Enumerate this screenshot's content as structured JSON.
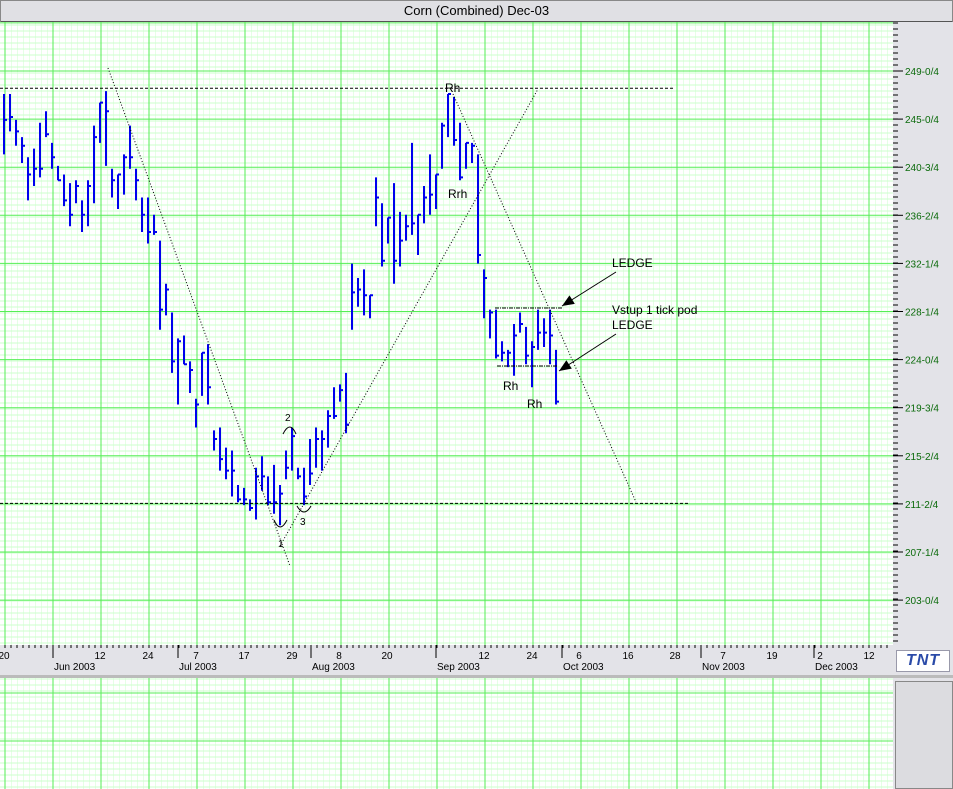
{
  "window": {
    "title": "Corn (Combined) Dec-03"
  },
  "logo": {
    "text": "TNT"
  },
  "colors": {
    "bar": "#0000ee",
    "grid_major": "#55ee55",
    "grid_minor": "#ccffcc",
    "axis_label": "#0a6a0a"
  },
  "chart_data": {
    "type": "ohlc",
    "title": "Corn (Combined) Dec-03",
    "fields": [
      "high",
      "low",
      "close"
    ],
    "bars": [
      [
        247.0,
        241.75,
        244.75
      ],
      [
        247.0,
        243.75,
        245.0
      ],
      [
        244.75,
        242.5,
        243.75
      ],
      [
        243.25,
        241.0,
        242.5
      ],
      [
        241.5,
        237.75,
        240.0
      ],
      [
        242.25,
        239.0,
        240.5
      ],
      [
        244.5,
        239.75,
        240.5
      ],
      [
        245.5,
        243.25,
        243.5
      ],
      [
        242.75,
        240.5,
        241.5
      ],
      [
        240.75,
        239.5,
        239.5
      ],
      [
        240.0,
        237.25,
        237.75
      ],
      [
        239.25,
        235.5,
        236.5
      ],
      [
        239.5,
        237.5,
        239.0
      ],
      [
        237.75,
        235.0,
        236.5
      ],
      [
        239.5,
        235.5,
        239.0
      ],
      [
        244.25,
        237.5,
        243.25
      ],
      [
        246.25,
        242.75,
        246.25
      ],
      [
        247.25,
        240.75,
        245.5
      ],
      [
        240.5,
        238.0,
        239.5
      ],
      [
        240.0,
        237.0,
        240.0
      ],
      [
        241.75,
        238.25,
        241.5
      ],
      [
        244.25,
        240.5,
        241.5
      ],
      [
        240.5,
        237.75,
        239.5
      ],
      [
        238.0,
        235.0,
        236.5
      ],
      [
        238.0,
        234.0,
        235.0
      ],
      [
        236.5,
        234.75,
        235.0
      ],
      [
        234.25,
        226.5,
        228.25
      ],
      [
        230.5,
        227.75,
        230.0
      ],
      [
        228.0,
        222.75,
        223.75
      ],
      [
        225.75,
        220.0,
        225.5
      ],
      [
        226.0,
        223.5,
        223.5
      ],
      [
        223.75,
        221.0,
        223.0
      ],
      [
        220.5,
        218.0,
        220.0
      ],
      [
        224.5,
        220.75,
        224.5
      ],
      [
        225.25,
        220.0,
        221.5
      ],
      [
        217.75,
        216.0,
        217.0
      ],
      [
        218.0,
        214.25,
        215.25
      ],
      [
        216.25,
        213.5,
        214.25
      ],
      [
        216.0,
        212.0,
        214.25
      ],
      [
        213.0,
        211.5,
        211.75
      ],
      [
        212.75,
        211.25,
        211.75
      ],
      [
        211.75,
        210.75,
        211.0
      ],
      [
        214.5,
        210.0,
        213.75
      ],
      [
        215.5,
        212.5,
        213.75
      ],
      [
        213.75,
        211.25,
        211.5
      ],
      [
        214.75,
        210.5,
        211.5
      ],
      [
        213.0,
        209.5,
        212.25
      ],
      [
        216.0,
        213.5,
        214.5
      ],
      [
        218.0,
        214.25,
        217.25
      ],
      [
        214.5,
        213.5,
        213.75
      ],
      [
        214.5,
        211.25,
        212.0
      ],
      [
        217.0,
        213.0,
        214.0
      ],
      [
        218.0,
        214.5,
        217.0
      ],
      [
        217.75,
        214.25,
        217.0
      ],
      [
        219.5,
        216.25,
        219.0
      ],
      [
        221.5,
        218.75,
        219.0
      ],
      [
        221.75,
        220.25,
        221.25
      ],
      [
        222.75,
        217.5,
        218.25
      ],
      [
        232.25,
        226.5,
        229.75
      ],
      [
        231.0,
        228.5,
        230.0
      ],
      [
        231.75,
        227.75,
        229.5
      ],
      [
        229.5,
        227.5,
        229.5
      ],
      [
        239.75,
        235.5,
        238.0
      ],
      [
        237.5,
        232.0,
        232.5
      ],
      [
        236.25,
        234.0,
        236.25
      ],
      [
        239.25,
        230.5,
        232.5
      ],
      [
        236.75,
        232.0,
        234.25
      ],
      [
        236.5,
        234.25,
        235.5
      ],
      [
        242.75,
        234.75,
        235.75
      ],
      [
        236.5,
        233.0,
        236.5
      ],
      [
        239.0,
        235.75,
        238.0
      ],
      [
        241.75,
        236.5,
        238.25
      ],
      [
        240.0,
        237.0,
        240.0
      ],
      [
        244.5,
        240.5,
        244.25
      ],
      [
        247.0,
        243.25,
        247.0
      ],
      [
        246.75,
        242.5,
        243.0
      ],
      [
        244.5,
        239.5,
        239.75
      ],
      [
        242.75,
        240.5,
        242.75
      ],
      [
        242.75,
        241.0,
        242.5
      ],
      [
        241.75,
        232.25,
        233.0
      ],
      [
        231.75,
        227.5,
        231.0
      ],
      [
        228.25,
        225.75,
        228.0
      ],
      [
        228.25,
        224.0,
        224.25
      ],
      [
        225.5,
        223.75,
        224.5
      ],
      [
        224.75,
        223.25,
        224.5
      ],
      [
        227.0,
        222.5,
        226.0
      ],
      [
        228.0,
        226.25,
        227.0
      ],
      [
        226.75,
        223.5,
        224.25
      ],
      [
        225.5,
        221.5,
        225.0
      ],
      [
        228.25,
        224.75,
        226.25
      ],
      [
        227.5,
        225.0,
        226.25
      ],
      [
        228.25,
        223.5,
        226.0
      ],
      [
        224.75,
        220.0,
        220.25
      ]
    ],
    "y_range": [
      199.1,
      253.25
    ],
    "y_ticks": [
      "249-0/4",
      "245-0/4",
      "240-3/4",
      "236-2/4",
      "232-1/4",
      "228-1/4",
      "224-0/4",
      "219-3/4",
      "215-2/4",
      "211-2/4",
      "207-1/4",
      "203-0/4"
    ],
    "x_day_ticks": [
      "20",
      "12",
      "24",
      "7",
      "17",
      "29",
      "8",
      "20",
      "12",
      "24",
      "6",
      "16",
      "28",
      "7",
      "19",
      "2",
      "12"
    ],
    "x_month_labels": [
      "Jun 2003",
      "Jul 2003",
      "Aug 2003",
      "Sep 2003",
      "Oct 2003",
      "Nov 2003",
      "Dec 2003"
    ],
    "horizontal_lines": [
      247.5,
      211.4
    ],
    "annotations": {
      "rh_top": "Rh",
      "rrh": "Rrh",
      "rh_low1": "Rh",
      "rh_low2": "Rh",
      "ledge1": "LEDGE",
      "vstup": "Vstup 1 tick pod",
      "ledge2": "LEDGE",
      "pt1": "1",
      "pt2": "2",
      "pt3": "3"
    },
    "grid": true
  }
}
